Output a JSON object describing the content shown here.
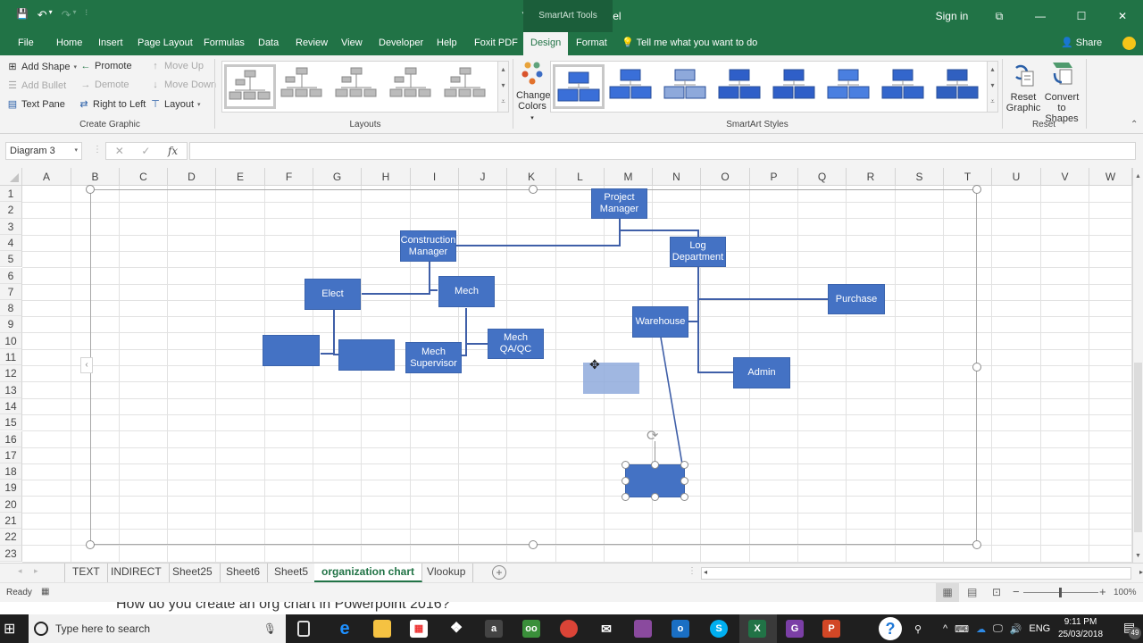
{
  "titlebar": {
    "title": "YouTube.xlsx  -  Excel",
    "context_tab_group": "SmartArt Tools",
    "sign_in": "Sign in",
    "qat": {
      "save": "💾",
      "undo": "↶",
      "undo_dd": "▾",
      "redo": "↷",
      "redo_dd": "▾",
      "customize": "⫶"
    },
    "window": {
      "ribbon_display": "⧉",
      "minimize": "—",
      "maximize": "☐",
      "close": "✕"
    }
  },
  "ribbon_tabs": [
    "File",
    "Home",
    "Insert",
    "Page Layout",
    "Formulas",
    "Data",
    "Review",
    "View",
    "Developer",
    "Help",
    "Foxit PDF",
    "Design",
    "Format"
  ],
  "active_tab": "Design",
  "tell_me": "Tell me what you want to do",
  "share": "Share",
  "create_graphic": {
    "label": "Create Graphic",
    "add_shape": "Add Shape",
    "add_bullet": "Add Bullet",
    "text_pane": "Text Pane",
    "promote": "Promote",
    "demote": "Demote",
    "right_to_left": "Right to Left",
    "move_up": "Move Up",
    "move_down": "Move Down",
    "layout": "Layout"
  },
  "layouts": {
    "label": "Layouts",
    "count": 5,
    "selected": 0
  },
  "change_colors": {
    "line1": "Change",
    "line2": "Colors"
  },
  "smartart_styles": {
    "label": "SmartArt Styles",
    "count": 8,
    "selected": 0
  },
  "reset": {
    "label": "Reset",
    "reset_graphic_1": "Reset",
    "reset_graphic_2": "Graphic",
    "convert_1": "Convert",
    "convert_2": "to Shapes"
  },
  "formula_bar": {
    "name_box": "Diagram 3",
    "cancel": "✕",
    "enter": "✓",
    "fx": "fx",
    "value": ""
  },
  "columns": [
    "A",
    "B",
    "C",
    "D",
    "E",
    "F",
    "G",
    "H",
    "I",
    "J",
    "K",
    "L",
    "M",
    "N",
    "O",
    "P",
    "Q",
    "R",
    "S",
    "T",
    "U",
    "V",
    "W"
  ],
  "rows": [
    "1",
    "2",
    "3",
    "4",
    "5",
    "6",
    "7",
    "8",
    "9",
    "10",
    "11",
    "12",
    "13",
    "14",
    "15",
    "16",
    "17",
    "18",
    "19",
    "20",
    "21",
    "22",
    "23"
  ],
  "org_chart": {
    "nodes": {
      "project_manager": "Project Manager",
      "construction_manager": "Construction Manager",
      "log_department": "Log Department",
      "elect": "Elect",
      "mech": "Mech",
      "mech_supervisor": "Mech Supervisor",
      "mech_qaqc": "Mech QA/QC",
      "warehouse": "Warehouse",
      "purchase": "Purchase",
      "admin": "Admin",
      "blank_1": "",
      "blank_2": "",
      "blank_selected": ""
    },
    "accent": "#4472c4"
  },
  "sheet_tabs": [
    "TEXT",
    "INDIRECT",
    "Sheet25",
    "Sheet6",
    "Sheet5",
    "organization chart",
    "Vlookup"
  ],
  "active_sheet": "organization chart",
  "status": {
    "ready": "Ready",
    "zoom": "100%",
    "zoom_minus": "−",
    "zoom_plus": "+"
  },
  "background_caption": "How do you create an org chart in Powerpoint 2016?",
  "taskbar": {
    "search_placeholder": "Type here to search",
    "tray_lang": "ENG",
    "time": "9:11 PM",
    "date": "25/03/2018",
    "notifications": "49"
  },
  "theme": {
    "excel_green": "#217346",
    "smartart_blue": "#4472c4"
  }
}
